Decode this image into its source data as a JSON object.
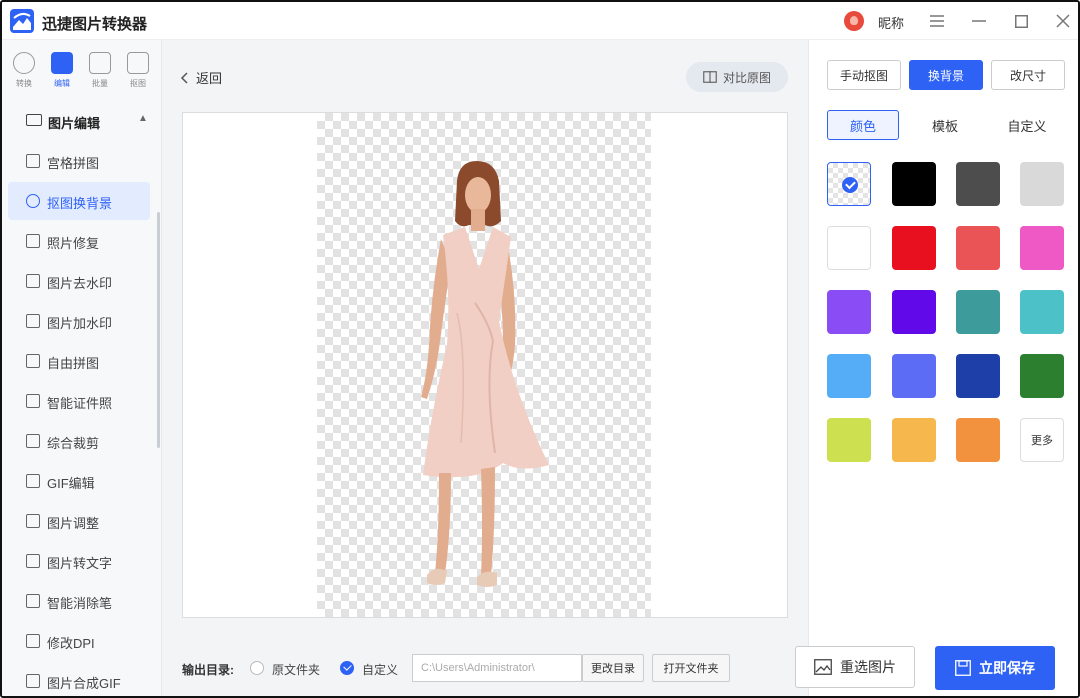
{
  "app": {
    "title": "迅捷图片转换器",
    "user_name": "昵称"
  },
  "sidebar": {
    "top_tabs": [
      {
        "label": "转换",
        "icon": "convert-icon"
      },
      {
        "label": "编辑",
        "icon": "edit-icon"
      },
      {
        "label": "批量",
        "icon": "batch-icon"
      },
      {
        "label": "抠图",
        "icon": "cutout-icon"
      }
    ],
    "section_label": "图片编辑",
    "items": [
      {
        "label": "宫格拼图",
        "icon": "grid-icon"
      },
      {
        "label": "抠图换背景",
        "icon": "cutout-icon"
      },
      {
        "label": "照片修复",
        "icon": "photo-repair-icon"
      },
      {
        "label": "图片去水印",
        "icon": "remove-watermark-icon"
      },
      {
        "label": "图片加水印",
        "icon": "add-watermark-icon"
      },
      {
        "label": "自由拼图",
        "icon": "collage-icon"
      },
      {
        "label": "智能证件照",
        "icon": "id-photo-icon"
      },
      {
        "label": "综合裁剪",
        "icon": "crop-icon"
      },
      {
        "label": "GIF编辑",
        "icon": "gif-icon"
      },
      {
        "label": "图片调整",
        "icon": "adjust-icon"
      },
      {
        "label": "图片转文字",
        "icon": "ocr-icon"
      },
      {
        "label": "智能消除笔",
        "icon": "eraser-icon"
      },
      {
        "label": "修改DPI",
        "icon": "dpi-icon"
      },
      {
        "label": "图片合成GIF",
        "icon": "make-gif-icon"
      }
    ]
  },
  "center": {
    "back_label": "返回",
    "compare_label": "对比原图",
    "output": {
      "label": "输出目录:",
      "option_original": "原文件夹",
      "option_custom": "自定义",
      "path_value": "C:\\Users\\Administrator\\",
      "change_dir_label": "更改目录",
      "open_folder_label": "打开文件夹"
    }
  },
  "right": {
    "mode_buttons": [
      "手动抠图",
      "换背景",
      "改尺寸"
    ],
    "active_mode": "换背景",
    "sub_tabs": [
      "颜色",
      "模板",
      "自定义"
    ],
    "active_sub_tab": "颜色",
    "more_label": "更多",
    "swatch_colors": [
      "transparent",
      "#000000",
      "#4d4d4d",
      "#d9d9d9",
      "#ffffff",
      "#e8101e",
      "#ea5456",
      "#ee59c6",
      "#8a4cf5",
      "#6109e8",
      "#3d9b9c",
      "#4cc2c8",
      "#55adf7",
      "#5c6cf5",
      "#1e3fa8",
      "#2b7f2e",
      "#cde150",
      "#f6b84c",
      "#f2923f",
      "more"
    ],
    "reselect_label": "重选图片",
    "save_label": "立即保存"
  },
  "accent_color": "#2e62f5"
}
